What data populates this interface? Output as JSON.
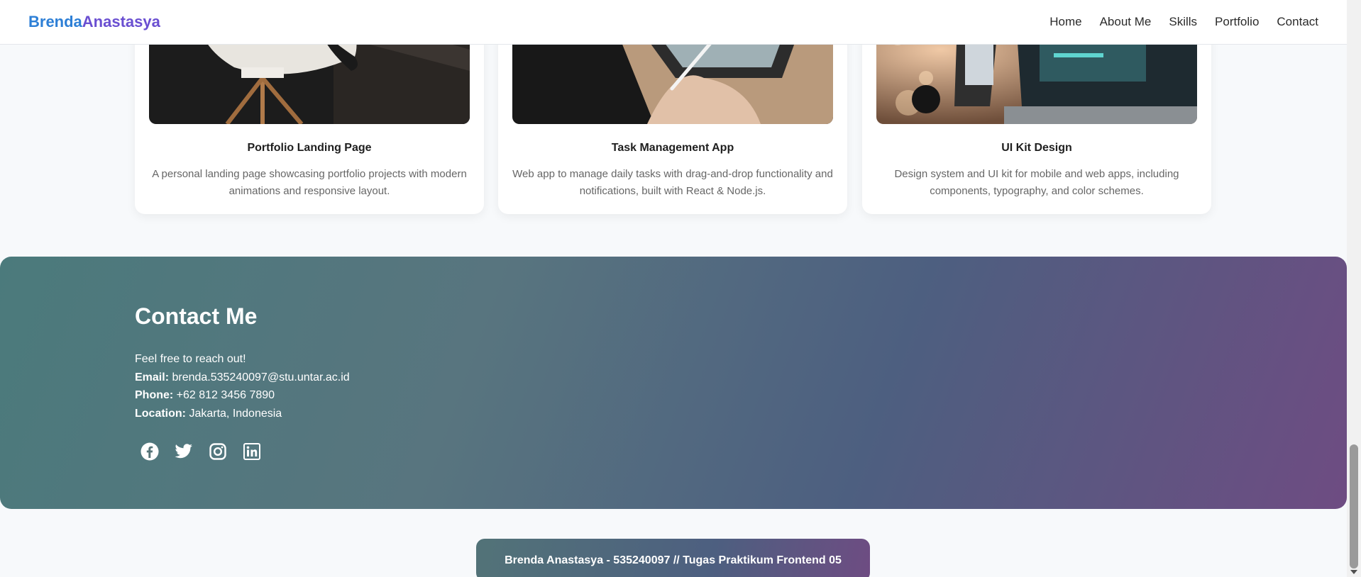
{
  "navbar": {
    "brand_first": "Brenda",
    "brand_last": "Anastasya",
    "links": [
      "Home",
      "About Me",
      "Skills",
      "Portfolio",
      "Contact"
    ]
  },
  "projects": [
    {
      "title": "Portfolio Landing Page",
      "description": "A personal landing page showcasing portfolio projects with modern animations and responsive layout."
    },
    {
      "title": "Task Management App",
      "description": "Web app to manage daily tasks with drag-and-drop functionality and notifications, built with React & Node.js."
    },
    {
      "title": "UI Kit Design",
      "description": "Design system and UI kit for mobile and web apps, including components, typography, and color schemes."
    }
  ],
  "contact": {
    "heading": "Contact Me",
    "intro": "Feel free to reach out!",
    "email_label": "Email:",
    "email": "brenda.535240097@stu.untar.ac.id",
    "phone_label": "Phone:",
    "phone": "+62 812 3456 7890",
    "location_label": "Location:",
    "location": "Jakarta, Indonesia",
    "socials": [
      "facebook-icon",
      "twitter-icon",
      "instagram-icon",
      "linkedin-icon"
    ]
  },
  "footer": {
    "text": "Brenda Anastasya - 535240097 // Tugas Praktikum Frontend 05"
  },
  "colors": {
    "brand_first": "#2d7fd6",
    "brand_last": "#6a4fd1",
    "background": "#f7f9fb"
  }
}
